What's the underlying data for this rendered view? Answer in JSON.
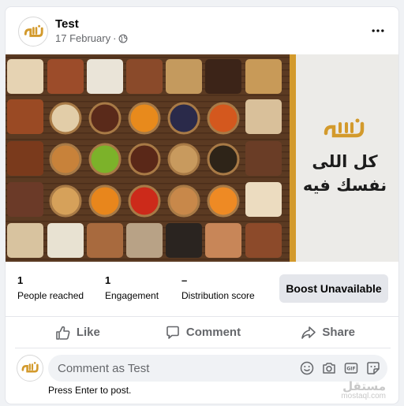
{
  "post": {
    "page_name": "Test",
    "date": "17 February",
    "separator": "·",
    "privacy_icon": "globe-icon",
    "more_icon": "more-horizontal-icon"
  },
  "image": {
    "brand_logo_text": "الباروق",
    "tagline_line1": "كل اللى",
    "tagline_line2": "نفسك فيه",
    "stripe_color": "#d39a2c"
  },
  "stats": {
    "people_reached_value": "1",
    "people_reached_label": "People reached",
    "engagement_value": "1",
    "engagement_label": "Engagement",
    "distribution_value": "–",
    "distribution_label": "Distribution score",
    "boost_label": "Boost Unavailable"
  },
  "actions": {
    "like_label": "Like",
    "comment_label": "Comment",
    "share_label": "Share"
  },
  "comment": {
    "placeholder": "Comment as Test",
    "hint": "Press Enter to post.",
    "icons": [
      "emoji-icon",
      "camera-icon",
      "gif-icon",
      "sticker-icon"
    ]
  },
  "watermark": {
    "arabic": "مستقل",
    "latin": "mostaql.com"
  }
}
